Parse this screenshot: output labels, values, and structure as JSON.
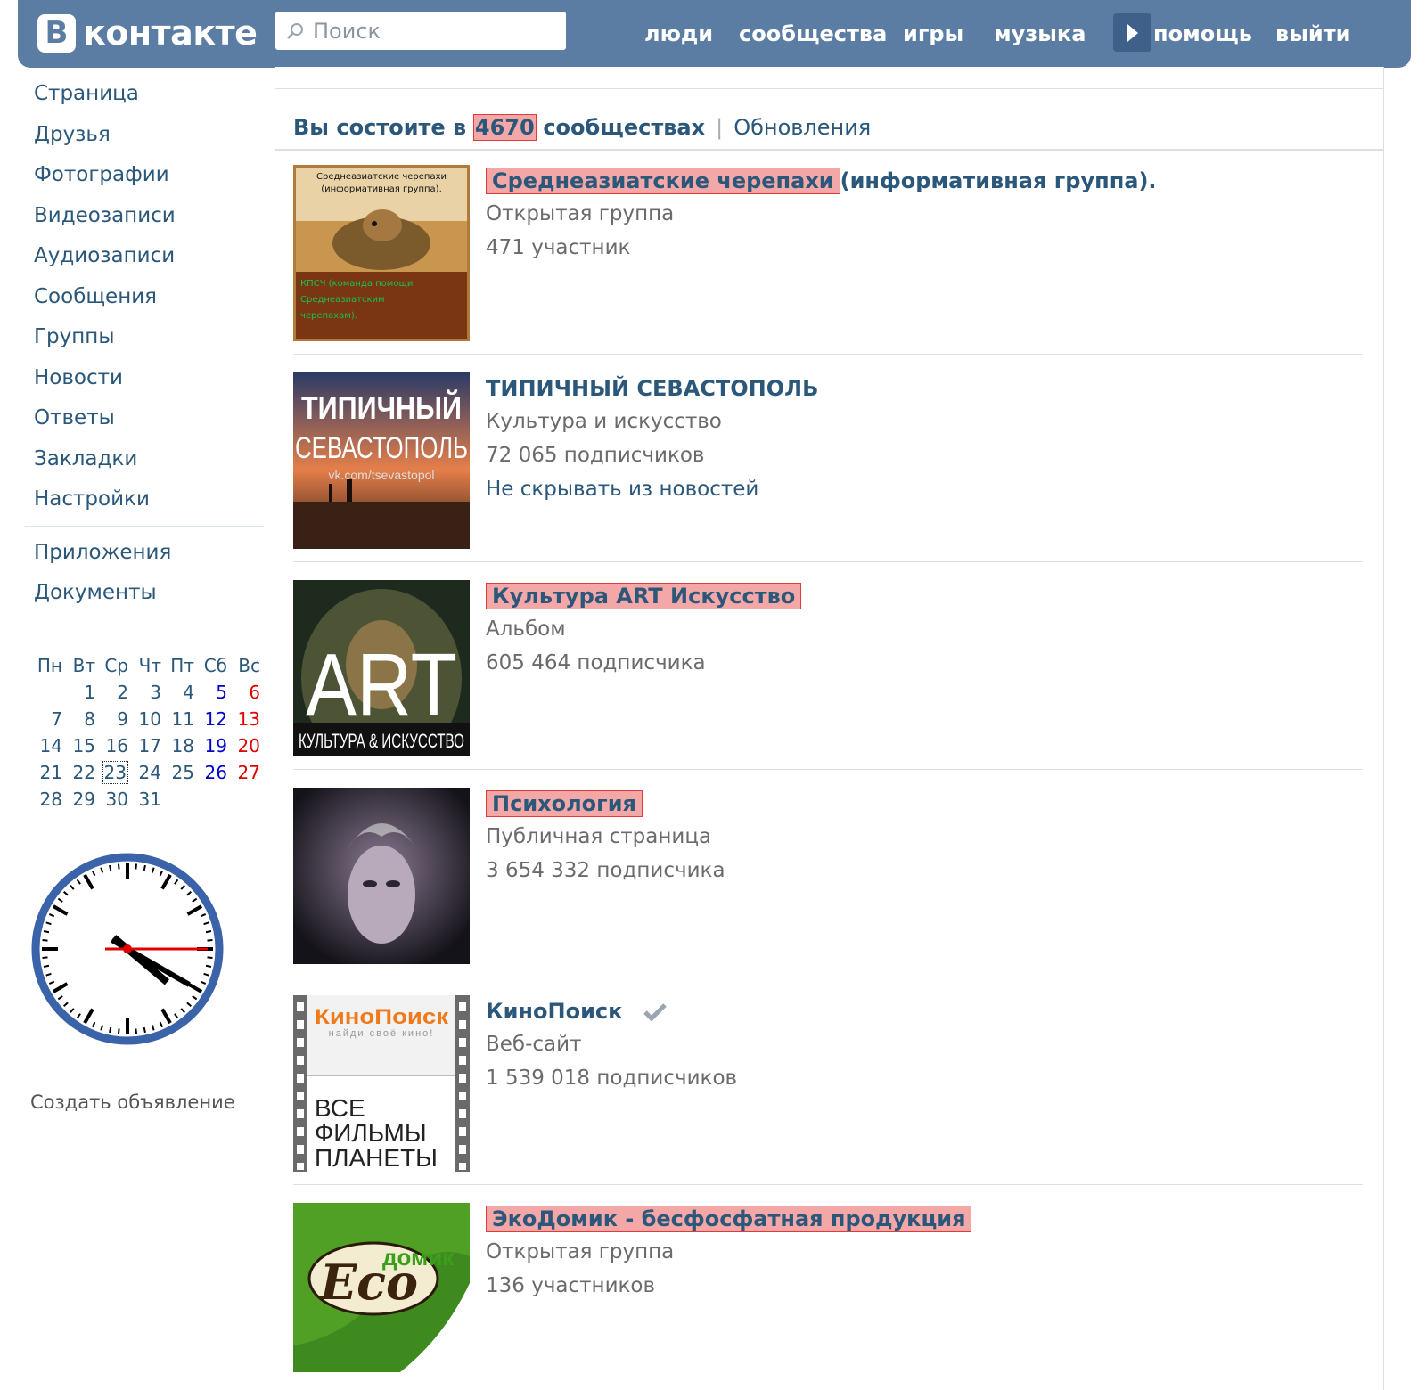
{
  "header": {
    "logo_letter": "B",
    "logo_text": "контакте",
    "search_placeholder": "Поиск",
    "nav": [
      "люди",
      "сообщества",
      "игры",
      "музыка",
      "помощь",
      "выйти"
    ]
  },
  "sidebar": {
    "items": [
      "Страница",
      "Друзья",
      "Фотографии",
      "Видеозаписи",
      "Аудиозаписи",
      "Сообщения",
      "Группы",
      "Новости",
      "Ответы",
      "Закладки",
      "Настройки"
    ],
    "items2": [
      "Приложения",
      "Документы"
    ],
    "calendar": {
      "days": [
        "Пн",
        "Вт",
        "Ср",
        "Чт",
        "Пт",
        "Сб",
        "Вс"
      ],
      "weeks": [
        [
          "",
          "1",
          "2",
          "3",
          "4",
          "5",
          "6"
        ],
        [
          "7",
          "8",
          "9",
          "10",
          "11",
          "12",
          "13"
        ],
        [
          "14",
          "15",
          "16",
          "17",
          "18",
          "19",
          "20"
        ],
        [
          "21",
          "22",
          "23",
          "24",
          "25",
          "26",
          "27"
        ],
        [
          "28",
          "29",
          "30",
          "31",
          "",
          "",
          ""
        ]
      ],
      "today": "23"
    },
    "clock": {
      "hour": 4,
      "minute": 20,
      "second": 15
    },
    "ad_link": "Создать объявление"
  },
  "summary": {
    "prefix": "Вы состоите в",
    "count": "4670",
    "suffix": "сообществах",
    "updates": "Обновления"
  },
  "groups": [
    {
      "name_hl": "Среднеазиатские черепахи",
      "name_rest": "(информативная группа).",
      "type": "Открытая группа",
      "members": "471 участник",
      "action": "",
      "img_title": "Среднеазиатские черепахи (информативная группа).",
      "img_caption": "КПСЧ (команда помощи Среднеазиатским черепахам).",
      "verified": false
    },
    {
      "name_hl": "",
      "name_rest": "ТИПИЧНЫЙ СЕВАСТОПОЛЬ",
      "type": "Культура и искусство",
      "members": "72 065 подписчиков",
      "action": "Не скрывать из новостей",
      "img_title": "ТИПИЧНЫЙ",
      "img_caption": "СЕВАСТОПОЛЬ",
      "img_url": "vk.com/tsevastopol",
      "verified": false
    },
    {
      "name_hl": "Культура ART Искусство",
      "name_rest": "",
      "type": "Альбом",
      "members": "605 464 подписчика",
      "action": "",
      "img_title": "ART",
      "img_caption": "КУЛЬТУРА & ИСКУССТВО",
      "verified": false
    },
    {
      "name_hl": "Психология",
      "name_rest": "",
      "type": "Публичная страница",
      "members": "3 654 332 подписчика",
      "action": "",
      "verified": false
    },
    {
      "name_hl": "",
      "name_rest": "КиноПоиск",
      "type": "Веб-сайт",
      "members": "1 539 018 подписчиков",
      "action": "",
      "img_title": "КиноПоиск",
      "img_sub": "найди своё кино!",
      "img_caption": [
        "ВСЕ",
        "ФИЛЬМЫ",
        "ПЛАНЕТЫ"
      ],
      "verified": true
    },
    {
      "name_hl": "ЭкоДомик - бесфосфатная продукция",
      "name_rest": "",
      "type": "Открытая группа",
      "members": "136 участников",
      "action": "",
      "img_title": "Eco",
      "img_sub": "домик",
      "verified": false
    }
  ],
  "colors": {
    "header": "#5b7ca3",
    "link": "#2b587a",
    "highlight_bg": "#f4a7a7",
    "highlight_border": "#e23a3a"
  }
}
